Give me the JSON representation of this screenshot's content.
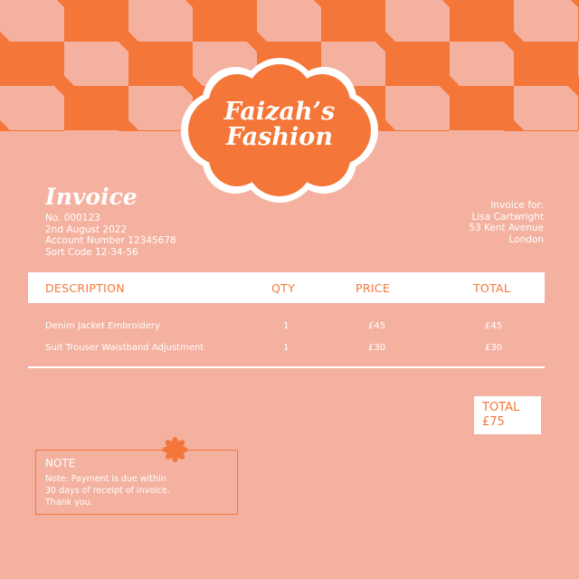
{
  "brand": {
    "line1": "Faizah’s",
    "line2": "Fashion",
    "colors": {
      "accent": "#f47638",
      "background": "#f4b1a0",
      "white": "#ffffff"
    }
  },
  "invoice": {
    "title": "Invoice",
    "number": "No. 000123",
    "date": "2nd August 2022",
    "account": "Account Number 12345678",
    "sort_code": "Sort Code 12-34-56"
  },
  "recipient": {
    "label": "Invoice for:",
    "name": "Lisa Cartwright",
    "address1": "53 Kent Avenue",
    "address2": "London"
  },
  "table": {
    "headers": {
      "description": "DESCRIPTION",
      "qty": "QTY",
      "price": "PRICE",
      "total": "TOTAL"
    },
    "rows": [
      {
        "description": "Denim Jacket Embroidery",
        "qty": "1",
        "price": "£45",
        "total": "£45"
      },
      {
        "description": "Suit Trouser Waistband Adjustment",
        "qty": "1",
        "price": "£30",
        "total": "£30"
      }
    ]
  },
  "summary": {
    "total_label": "TOTAL",
    "total_value": "£75"
  },
  "note": {
    "title": "NOTE",
    "line1": "Note: Payment is due within",
    "line2": "30 days of receipt of invoice.",
    "line3": "Thank you."
  },
  "icons": {
    "logo_shape": "flower-badge",
    "note_decoration": "flower-icon"
  }
}
